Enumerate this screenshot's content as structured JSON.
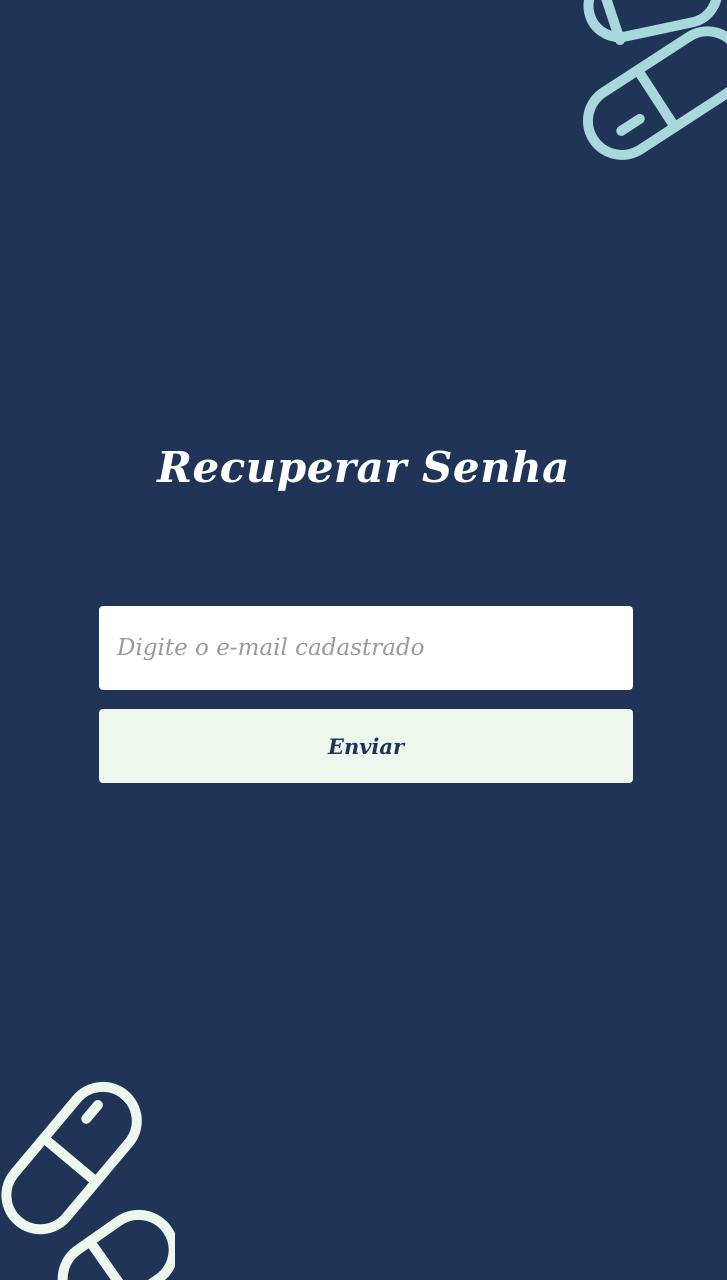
{
  "screen": {
    "title": "Recuperar Senha",
    "background_color": "#1f3456"
  },
  "form": {
    "email_placeholder": "Digite o e-mail cadastrado",
    "email_value": "",
    "submit_label": "Enviar",
    "button_color": "#eef7ee"
  },
  "decorations": {
    "top_right_icon": "capsule-pill-icon",
    "top_right_color": "#a9d8dc",
    "bottom_left_icon": "capsule-pill-icon",
    "bottom_left_color": "#eef7ee"
  }
}
